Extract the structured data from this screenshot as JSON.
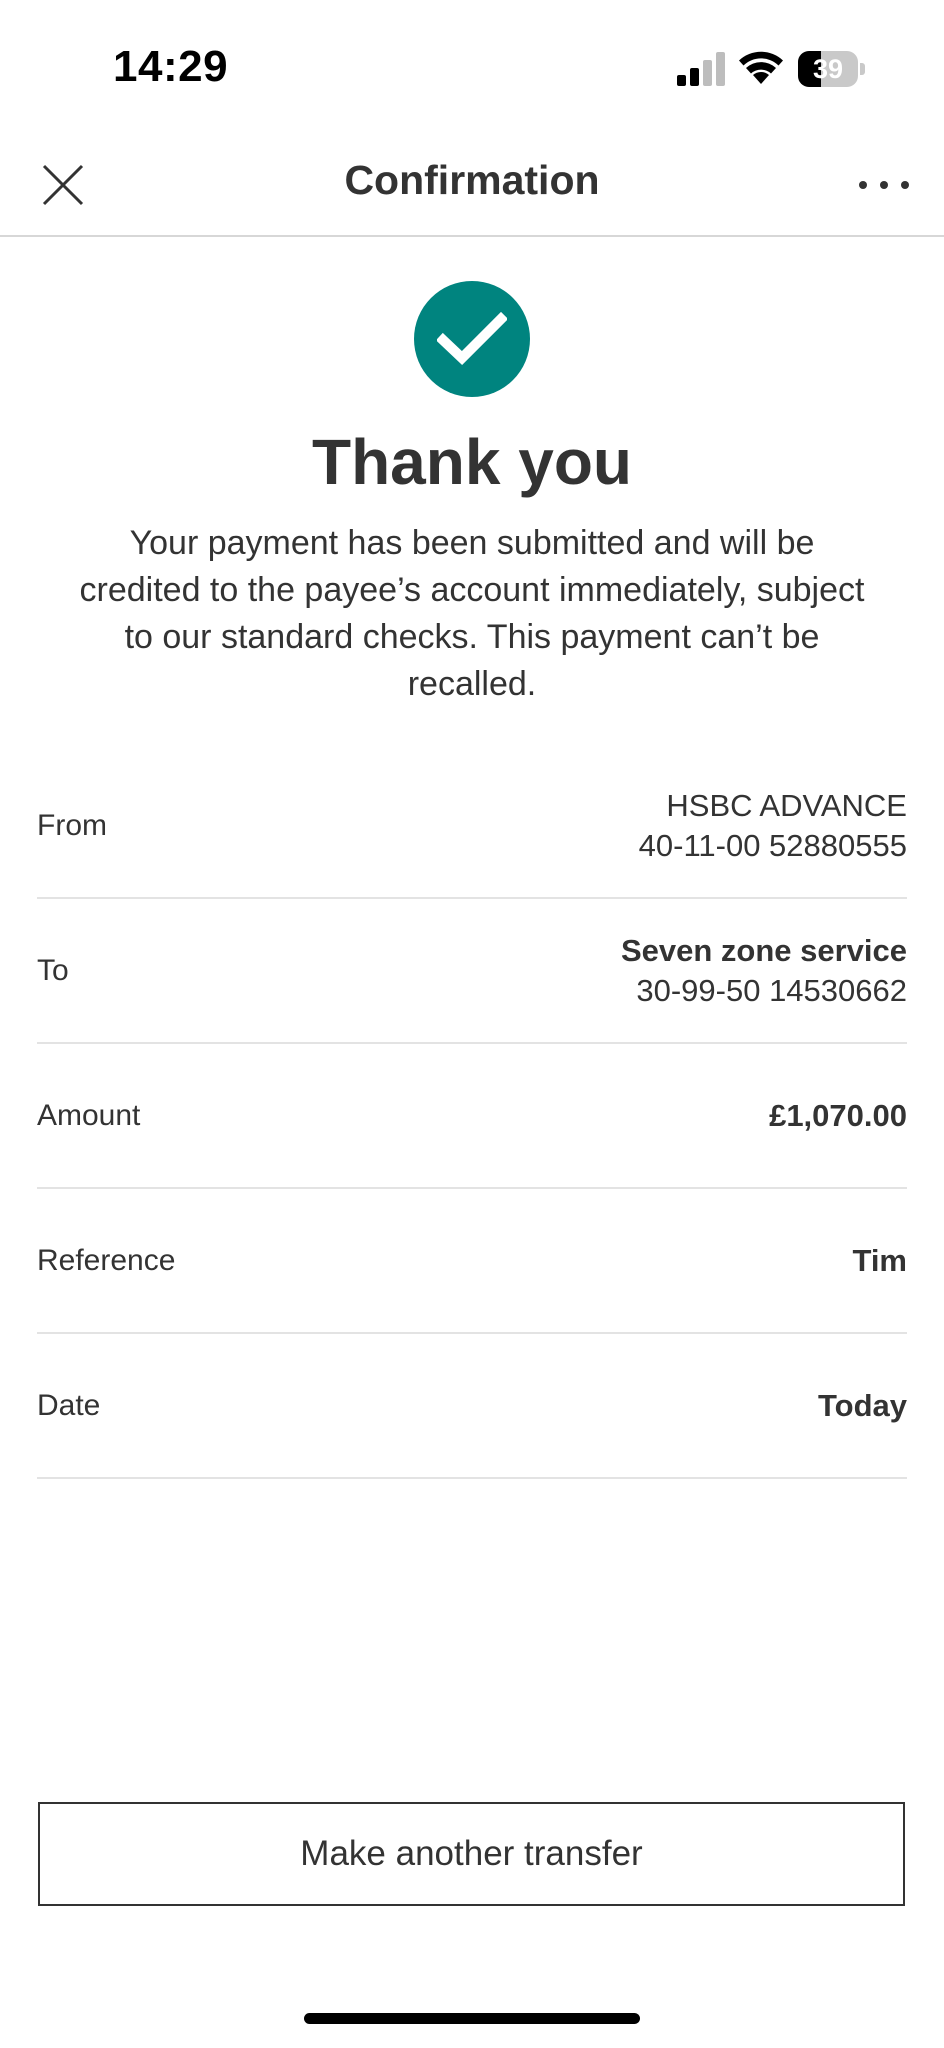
{
  "status_bar": {
    "time": "14:29",
    "battery": "39",
    "battery_level": 0.39
  },
  "header": {
    "title": "Confirmation"
  },
  "success": {
    "heading": "Thank you",
    "message": "Your payment has been submitted and will be credited to the payee’s account immediately, subject to our standard checks. This payment can’t be recalled."
  },
  "details": {
    "from": {
      "label": "From",
      "name": "HSBC ADVANCE",
      "account": "40-11-00 52880555"
    },
    "to": {
      "label": "To",
      "name": "Seven zone service",
      "account": "30-99-50 14530662"
    },
    "amount": {
      "label": "Amount",
      "value": "£1,070.00"
    },
    "reference": {
      "label": "Reference",
      "value": "Tim"
    },
    "date": {
      "label": "Date",
      "value": "Today"
    }
  },
  "actions": {
    "make_another_transfer": "Make another transfer"
  },
  "colors": {
    "accent": "#00847f",
    "text": "#333333",
    "divider": "#e3e3e3"
  },
  "icons": [
    "close-icon",
    "more-icon",
    "checkmark-icon",
    "signal-icon",
    "wifi-icon",
    "battery-icon"
  ]
}
